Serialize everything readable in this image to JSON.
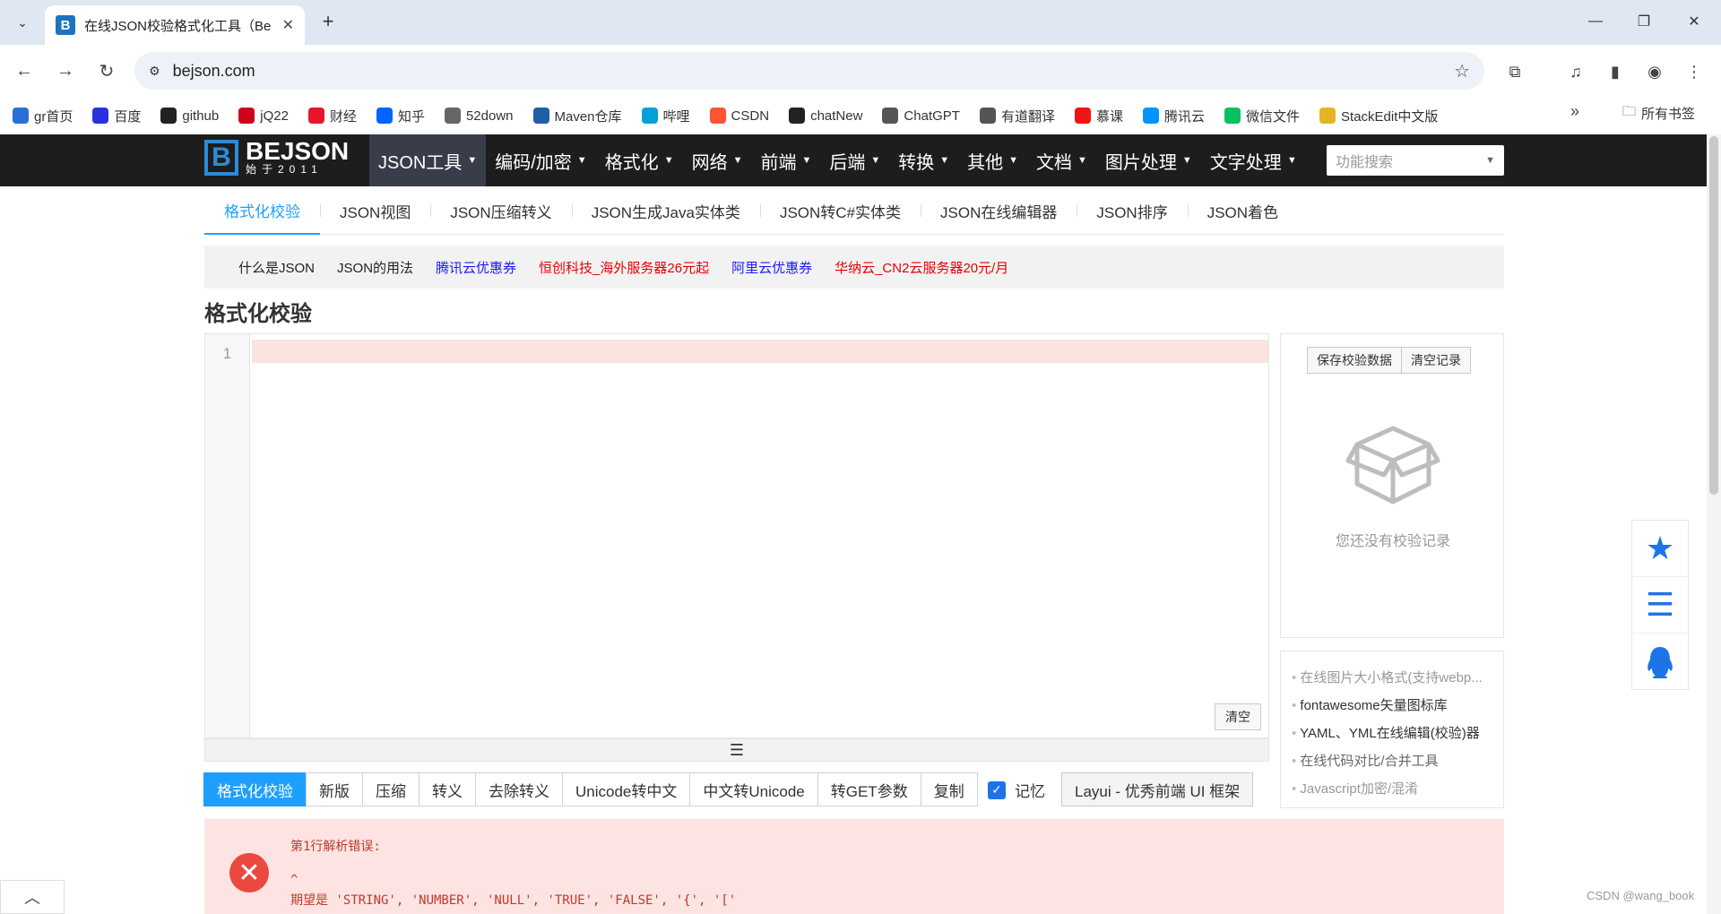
{
  "browser": {
    "tab_title": "在线JSON校验格式化工具（Be",
    "tab_favicon": "B",
    "url": "bejson.com"
  },
  "bookmarks": {
    "items": [
      {
        "label": "gr首页",
        "color": "#2a6fd6"
      },
      {
        "label": "百度",
        "color": "#2932e1"
      },
      {
        "label": "github",
        "color": "#222222"
      },
      {
        "label": "jQ22",
        "color": "#d0021b"
      },
      {
        "label": "财经",
        "color": "#e6162d"
      },
      {
        "label": "知乎",
        "color": "#0066ff"
      },
      {
        "label": "52down",
        "color": "#666666"
      },
      {
        "label": "Maven仓库",
        "color": "#1f5fa8"
      },
      {
        "label": "哔哩",
        "color": "#00a1d6"
      },
      {
        "label": "CSDN",
        "color": "#fc5531"
      },
      {
        "label": "chatNew",
        "color": "#222222"
      },
      {
        "label": "ChatGPT",
        "color": "#555555"
      },
      {
        "label": "有道翻译",
        "color": "#555555"
      },
      {
        "label": "慕课",
        "color": "#f01414"
      },
      {
        "label": "腾讯云",
        "color": "#0094ff"
      },
      {
        "label": "微信文件",
        "color": "#07c160"
      },
      {
        "label": "StackEdit中文版",
        "color": "#e6b422"
      }
    ],
    "all_label": "所有书签"
  },
  "site": {
    "logo_title": "BEJSON",
    "logo_sub": "始于2011",
    "nav": [
      "JSON工具",
      "编码/加密",
      "格式化",
      "网络",
      "前端",
      "后端",
      "转换",
      "其他",
      "文档",
      "图片处理",
      "文字处理"
    ],
    "search_placeholder": "功能搜索",
    "subtabs": [
      "格式化校验",
      "JSON视图",
      "JSON压缩转义",
      "JSON生成Java实体类",
      "JSON转C#实体类",
      "JSON在线编辑器",
      "JSON排序",
      "JSON着色"
    ],
    "links": [
      {
        "label": "什么是JSON",
        "color": "#222222"
      },
      {
        "label": "JSON的用法",
        "color": "#222222"
      },
      {
        "label": "腾讯云优惠券",
        "color": "#1a1aff"
      },
      {
        "label": "恒创科技_海外服务器26元起",
        "color": "#e60000"
      },
      {
        "label": "阿里云优惠券",
        "color": "#1a1aff"
      },
      {
        "label": "华纳云_CN2云服务器20元/月",
        "color": "#e60000"
      }
    ],
    "heading": "格式化校验"
  },
  "editor": {
    "line_number": "1",
    "clear_label": "清空",
    "resize_glyph": "☰"
  },
  "history": {
    "save_label": "保存校验数据",
    "clear_label": "清空记录",
    "empty_text": "您还没有校验记录"
  },
  "side_links": [
    {
      "label": "在线图片大小格式(支持webp...",
      "color": "#999999"
    },
    {
      "label": "fontawesome矢量图标库",
      "color": "#333333"
    },
    {
      "label": "YAML、YML在线编辑(校验)器",
      "color": "#333333"
    },
    {
      "label": "在线代码对比/合并工具",
      "color": "#666666"
    },
    {
      "label": "Javascript加密/混淆",
      "color": "#999999"
    }
  ],
  "actions": {
    "buttons": [
      "格式化校验",
      "新版",
      "压缩",
      "转义",
      "去除转义",
      "Unicode转中文",
      "中文转Unicode",
      "转GET参数",
      "复制"
    ],
    "remember_label": "记忆",
    "remember_checked": true,
    "layui_label": "Layui - 优秀前端 UI 框架"
  },
  "error": {
    "line1": "第1行解析错误:",
    "line2": "^",
    "line3": "期望是 'STRING', 'NUMBER', 'NULL', 'TRUE', 'FALSE', '{', '['"
  },
  "watermark": "CSDN @wang_book"
}
